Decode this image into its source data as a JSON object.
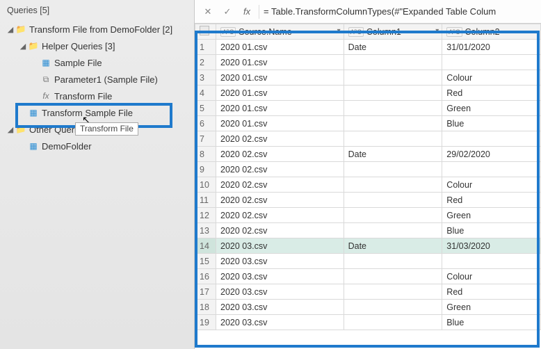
{
  "panel": {
    "title": "Queries [5]",
    "tree": [
      {
        "level": 1,
        "twisty": "◢",
        "icon": "folder",
        "label": "Transform File from DemoFolder [2]"
      },
      {
        "level": 2,
        "twisty": "◢",
        "icon": "folder",
        "label": "Helper Queries [3]"
      },
      {
        "level": 3,
        "twisty": "",
        "icon": "table",
        "label": "Sample File"
      },
      {
        "level": 3,
        "twisty": "",
        "icon": "param",
        "label": "Parameter1 (Sample File)"
      },
      {
        "level": 3,
        "twisty": "",
        "icon": "fx",
        "label": "Transform File"
      },
      {
        "level": 2,
        "twisty": "",
        "icon": "table",
        "label": "Transform Sample File"
      },
      {
        "level": 1,
        "twisty": "◢",
        "icon": "folder",
        "label": "Other Queries [1]"
      },
      {
        "level": 2,
        "twisty": "",
        "icon": "table",
        "label": "DemoFolder"
      }
    ],
    "tooltip": "Transform File"
  },
  "formulaBar": {
    "cancel": "✕",
    "commit": "✓",
    "fx": "fx",
    "text": "= Table.TransformColumnTypes(#\"Expanded Table Colum"
  },
  "grid": {
    "typeGlyph": "AᴮC",
    "dropdownGlyph": "▾",
    "columns": [
      "Source.Name",
      "Column1",
      "Column2"
    ],
    "selectedRow": 14,
    "rows": [
      {
        "n": 1,
        "c": [
          "2020 01.csv",
          "Date",
          "31/01/2020"
        ]
      },
      {
        "n": 2,
        "c": [
          "2020 01.csv",
          "",
          ""
        ]
      },
      {
        "n": 3,
        "c": [
          "2020 01.csv",
          "",
          "Colour"
        ]
      },
      {
        "n": 4,
        "c": [
          "2020 01.csv",
          "",
          "Red"
        ]
      },
      {
        "n": 5,
        "c": [
          "2020 01.csv",
          "",
          "Green"
        ]
      },
      {
        "n": 6,
        "c": [
          "2020 01.csv",
          "",
          "Blue"
        ]
      },
      {
        "n": 7,
        "c": [
          "2020 02.csv",
          "",
          ""
        ]
      },
      {
        "n": 8,
        "c": [
          "2020 02.csv",
          "Date",
          "29/02/2020"
        ]
      },
      {
        "n": 9,
        "c": [
          "2020 02.csv",
          "",
          ""
        ]
      },
      {
        "n": 10,
        "c": [
          "2020 02.csv",
          "",
          "Colour"
        ]
      },
      {
        "n": 11,
        "c": [
          "2020 02.csv",
          "",
          "Red"
        ]
      },
      {
        "n": 12,
        "c": [
          "2020 02.csv",
          "",
          "Green"
        ]
      },
      {
        "n": 13,
        "c": [
          "2020 02.csv",
          "",
          "Blue"
        ]
      },
      {
        "n": 14,
        "c": [
          "2020 03.csv",
          "Date",
          "31/03/2020"
        ]
      },
      {
        "n": 15,
        "c": [
          "2020 03.csv",
          "",
          ""
        ]
      },
      {
        "n": 16,
        "c": [
          "2020 03.csv",
          "",
          "Colour"
        ]
      },
      {
        "n": 17,
        "c": [
          "2020 03.csv",
          "",
          "Red"
        ]
      },
      {
        "n": 18,
        "c": [
          "2020 03.csv",
          "",
          "Green"
        ]
      },
      {
        "n": 19,
        "c": [
          "2020 03.csv",
          "",
          "Blue"
        ]
      }
    ]
  }
}
